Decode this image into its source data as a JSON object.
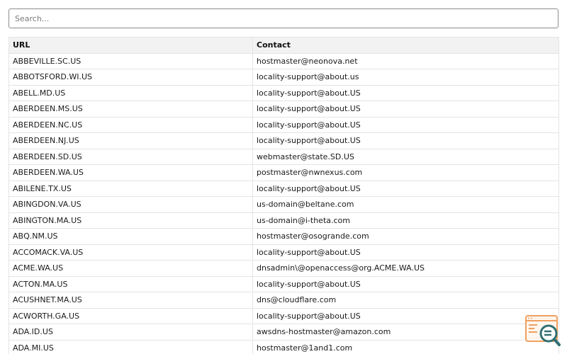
{
  "search": {
    "placeholder": "Search..."
  },
  "table": {
    "headers": {
      "url": "URL",
      "contact": "Contact"
    },
    "rows": [
      {
        "url": "ABBEVILLE.SC.US",
        "contact": "hostmaster@neonova.net"
      },
      {
        "url": "ABBOTSFORD.WI.US",
        "contact": "locality-support@about.us"
      },
      {
        "url": "ABELL.MD.US",
        "contact": "locality-support@about.US"
      },
      {
        "url": "ABERDEEN.MS.US",
        "contact": "locality-support@about.US"
      },
      {
        "url": "ABERDEEN.NC.US",
        "contact": "locality-support@about.US"
      },
      {
        "url": "ABERDEEN.NJ.US",
        "contact": "locality-support@about.US"
      },
      {
        "url": "ABERDEEN.SD.US",
        "contact": "webmaster@state.SD.US"
      },
      {
        "url": "ABERDEEN.WA.US",
        "contact": "postmaster@nwnexus.com"
      },
      {
        "url": "ABILENE.TX.US",
        "contact": "locality-support@about.US"
      },
      {
        "url": "ABINGDON.VA.US",
        "contact": "us-domain@beltane.com"
      },
      {
        "url": "ABINGTON.MA.US",
        "contact": "us-domain@i-theta.com"
      },
      {
        "url": "ABQ.NM.US",
        "contact": "hostmaster@osogrande.com"
      },
      {
        "url": "ACCOMACK.VA.US",
        "contact": "locality-support@about.US"
      },
      {
        "url": "ACME.WA.US",
        "contact": "dnsadmin\\@openaccess@org.ACME.WA.US"
      },
      {
        "url": "ACTON.MA.US",
        "contact": "locality-support@about.US"
      },
      {
        "url": "ACUSHNET.MA.US",
        "contact": "dns@cloudflare.com"
      },
      {
        "url": "ACWORTH.GA.US",
        "contact": "locality-support@about.US"
      },
      {
        "url": "ADA.ID.US",
        "contact": "awsdns-hostmaster@amazon.com"
      },
      {
        "url": "ADA.MI.US",
        "contact": "hostmaster@1and1.com"
      }
    ]
  },
  "colors": {
    "widget_orange": "#f0a060",
    "widget_teal": "#2f6f73"
  },
  "icons": {
    "corner_widget": "search-magnifier-icon"
  }
}
